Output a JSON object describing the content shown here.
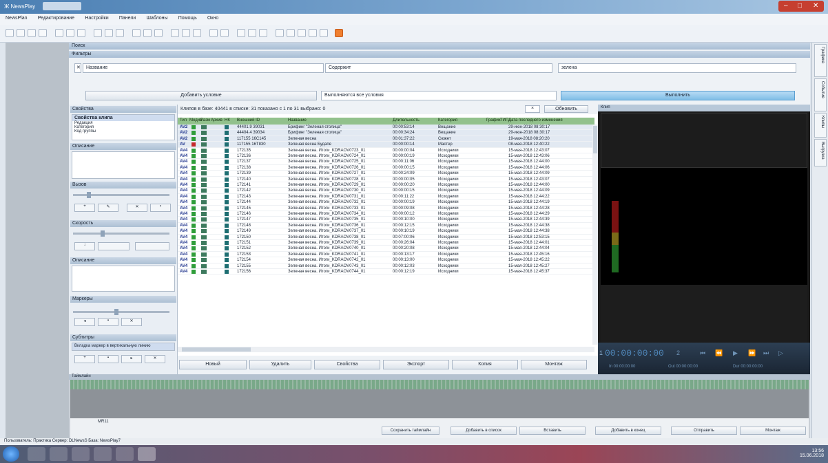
{
  "window": {
    "title": "Ж NewsPlay"
  },
  "menu": [
    "NewsPlan",
    "Редактирование",
    "Настройки",
    "Панели",
    "Шаблоны",
    "Помощь",
    "Окно"
  ],
  "panels": {
    "search": "Поиск",
    "filters": "Фильтры"
  },
  "filter": {
    "field1": "Название",
    "field2": "Содержит",
    "value": "зелена",
    "add_condition": "Добавить условие",
    "mode": "Выполняются все условия",
    "search_btn": "Выполнить"
  },
  "sidebar": {
    "props_title": "Свойства",
    "props_item": "Свойства клипа",
    "props_sub": [
      "Редакция",
      "Категория",
      "Код группы"
    ],
    "tags_title": "Описание",
    "volume_title": "Вызов",
    "speed_title": "Скорость",
    "markers_title": "Описание",
    "montage_title": "Маркеры",
    "subtitle_title": "Субтитры",
    "subtitle_text": "Вкладка маркер в вертикальную линию"
  },
  "grid": {
    "summary": "Клипов в базе: 40441 в списке: 31 показано с 1 по 31 выбрано: 0",
    "refresh": "Обновить",
    "headers": [
      "Тип",
      "Медиа",
      "Разм",
      "Архив",
      "НК",
      "Внешний ID",
      "Название",
      "Длительность",
      "Категория",
      "График",
      "ТИП",
      "Дата последнего изменения"
    ],
    "rows": [
      {
        "type": "AV2",
        "id": "44401.9 39031",
        "name": "Брифинг \"Зеленая столица\"",
        "dur": "00:00:53:14",
        "cat": "Вещание",
        "date": "29-июн-2018 08:30:17"
      },
      {
        "type": "AV2",
        "id": "44404.4 39034",
        "name": "Брифинг \"Зеленая столица\"",
        "dur": "00:00:34:24",
        "cat": "Вещание",
        "date": "29-июн-2018 08:30:17"
      },
      {
        "type": "AV2",
        "id": "117155 16C145",
        "name": "Зеленая весна",
        "dur": "00:01:37:22",
        "cat": "Сюжет",
        "date": "19-мая-2018 08:20:20"
      },
      {
        "type": "AV",
        "id": "117155 16T830",
        "name": "Зеленая весна Будапе",
        "dur": "00:00:00:14",
        "cat": "Мастер",
        "date": "08-мая-2018 12:40:22"
      },
      {
        "type": "AV4",
        "id": "172135",
        "name": "Зеленая весна. Итоги_KDRAOV0723_01",
        "dur": "00:00:00:04",
        "cat": "Исходники",
        "date": "15-мая-2018 12:43:07"
      },
      {
        "type": "AV4",
        "id": "172136",
        "name": "Зеленая весна. Итоги_KDRAOV0724_01",
        "dur": "00:00:00:19",
        "cat": "Исходники",
        "date": "15-мая-2018 12:43:06"
      },
      {
        "type": "AV4",
        "id": "172137",
        "name": "Зеленая весна. Итоги_KDRAOV0725_01",
        "dur": "00:00:11:06",
        "cat": "Исходники",
        "date": "15-мая-2018 12:44:00"
      },
      {
        "type": "AV4",
        "id": "172138",
        "name": "Зеленая весна. Итоги_KDRAOV0726_01",
        "dur": "00:00:00:15",
        "cat": "Исходники",
        "date": "15-мая-2018 12:44:06"
      },
      {
        "type": "AV4",
        "id": "172139",
        "name": "Зеленая весна. Итоги_KDRAOV0727_01",
        "dur": "00:00:24:09",
        "cat": "Исходники",
        "date": "15-мая-2018 12:44:09"
      },
      {
        "type": "AV4",
        "id": "172140",
        "name": "Зеленая весна. Итоги_KDRAOV0728_01",
        "dur": "00:00:00:05",
        "cat": "Исходники",
        "date": "15-мая-2018 12:43:07"
      },
      {
        "type": "AV4",
        "id": "172141",
        "name": "Зеленая весна. Итоги_KDRAOV0729_01",
        "dur": "00:00:00:20",
        "cat": "Исходники",
        "date": "15-мая-2018 12:44:00"
      },
      {
        "type": "AV4",
        "id": "172142",
        "name": "Зеленая весна. Итоги_KDRAOV0730_01",
        "dur": "00:00:00:15",
        "cat": "Исходники",
        "date": "15-мая-2018 12:44:09"
      },
      {
        "type": "AV4",
        "id": "172143",
        "name": "Зеленая весна. Итоги_KDRAOV0731_01",
        "dur": "00:00:11:22",
        "cat": "Исходники",
        "date": "15-мая-2018 12:44:22"
      },
      {
        "type": "AV4",
        "id": "172144",
        "name": "Зеленая весна. Итоги_KDRAOV0732_01",
        "dur": "00:00:00:19",
        "cat": "Исходники",
        "date": "15-мая-2018 12:44:19"
      },
      {
        "type": "AV4",
        "id": "172145",
        "name": "Зеленая весна. Итоги_KDRAOV0733_01",
        "dur": "00:00:09:08",
        "cat": "Исходники",
        "date": "15-мая-2018 12:44:28"
      },
      {
        "type": "AV4",
        "id": "172146",
        "name": "Зеленая весна. Итоги_KDRAOV0734_01",
        "dur": "00:00:00:12",
        "cat": "Исходники",
        "date": "15-мая-2018 12:44:29"
      },
      {
        "type": "AV4",
        "id": "172147",
        "name": "Зеленая весна. Итоги_KDRAOV0735_01",
        "dur": "00:00:10:00",
        "cat": "Исходники",
        "date": "15-мая-2018 12:44:39"
      },
      {
        "type": "AV4",
        "id": "172148",
        "name": "Зеленая весна. Итоги_KDRAOV0736_01",
        "dur": "00:00:12:15",
        "cat": "Исходники",
        "date": "15-мая-2018 12:44:38"
      },
      {
        "type": "AV4",
        "id": "172149",
        "name": "Зеленая весна. Итоги_KDRAOV0737_01",
        "dur": "00:00:10:19",
        "cat": "Исходники",
        "date": "15-мая-2018 12:44:38"
      },
      {
        "type": "AV4",
        "id": "172150",
        "name": "Зеленая весна. Итоги_KDRAOV0738_01",
        "dur": "00:07:00:06",
        "cat": "Исходники",
        "date": "15-мая-2018 12:53:15"
      },
      {
        "type": "AV4",
        "id": "172151",
        "name": "Зеленая весна. Итоги_KDRAOV0739_01",
        "dur": "00:00:26:04",
        "cat": "Исходники",
        "date": "15-мая-2018 12:44:01"
      },
      {
        "type": "AV4",
        "id": "172152",
        "name": "Зеленая весна. Итоги_KDRAOV0740_01",
        "dur": "00:00:20:08",
        "cat": "Исходники",
        "date": "15-мая-2018 12:44:04"
      },
      {
        "type": "AV4",
        "id": "172153",
        "name": "Зеленая весна. Итоги_KDRAOV0741_01",
        "dur": "00:00:13:17",
        "cat": "Исходники",
        "date": "15-мая-2018 12:45:16"
      },
      {
        "type": "AV4",
        "id": "172154",
        "name": "Зеленая весна. Итоги_KDRAOV0742_01",
        "dur": "00:00:13:00",
        "cat": "Исходники",
        "date": "15-мая-2018 12:45:22"
      },
      {
        "type": "AV4",
        "id": "172155",
        "name": "Зеленая весна. Итоги_KDRAOV0743_01",
        "dur": "00:00:12:03",
        "cat": "Исходники",
        "date": "15-мая-2018 12:45:27"
      },
      {
        "type": "AV4",
        "id": "172156",
        "name": "Зеленая весна. Итоги_KDRAOV0744_01",
        "dur": "00:00:12:19",
        "cat": "Исходники",
        "date": "15-мая-2018 12:45:37"
      }
    ],
    "bottom_buttons": [
      "Новый",
      "Удалить",
      "Свойства",
      "Экспорт",
      "Копия",
      "Монтаж"
    ]
  },
  "preview": {
    "title": "Клип",
    "timecode": "00:00:00:00",
    "in": "In 00:00:00:00",
    "out": "Out 00:00:00:00",
    "dur": "Dur 00:00:00:00"
  },
  "timeline": {
    "title": "Таймлайн",
    "label": "MR11",
    "buttons": [
      "Сохранить таймлайн",
      "Добавить в список",
      "Вставить",
      "Добавить в конец",
      "Отправить",
      "Монтаж"
    ]
  },
  "status": {
    "text": "Пользователь: Практика  Сервер: DLNewsS  База: NewsPlay7"
  },
  "tray": {
    "time": "13:56",
    "date": "15.06.2018"
  },
  "right_tabs": [
    "Графика",
    "Событие",
    "Клипы",
    "Выгрузка"
  ]
}
